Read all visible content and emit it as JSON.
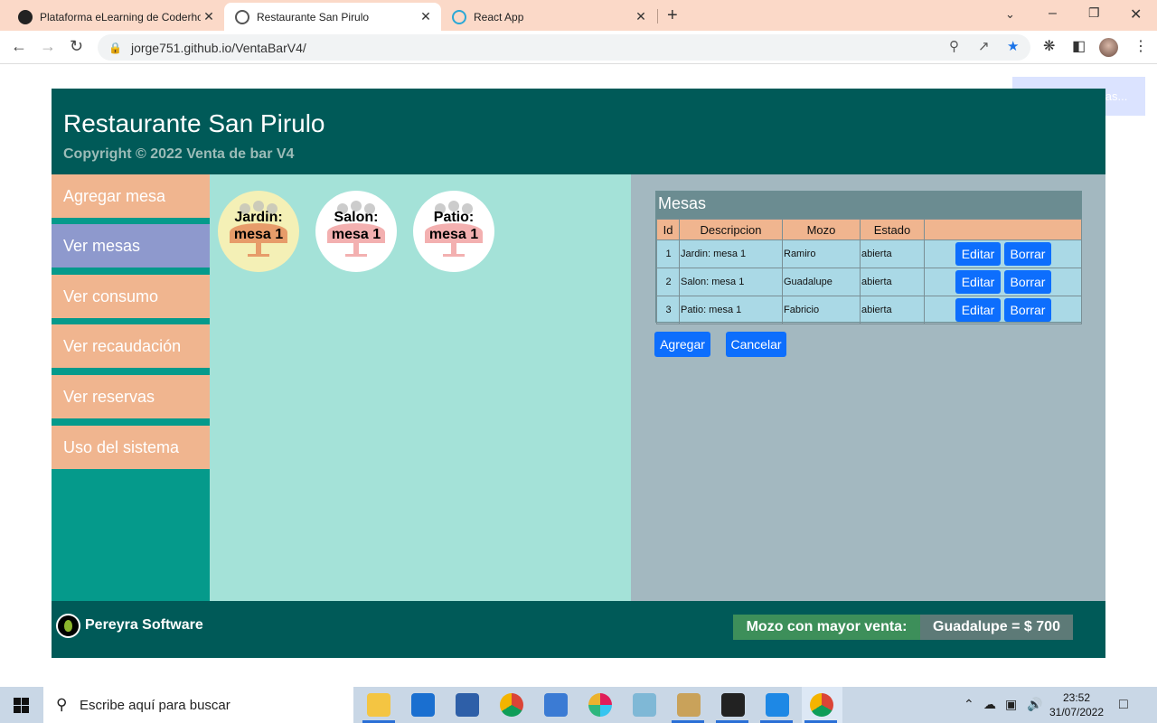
{
  "browser": {
    "tabs": [
      {
        "title": "Plataforma eLearning de Coderho",
        "close": "✕"
      },
      {
        "title": "Restaurante San Pirulo",
        "close": "✕"
      },
      {
        "title": "React App",
        "close": "✕"
      }
    ],
    "new_tab": "+",
    "url": "jorge751.github.io/VentaBarV4/"
  },
  "toast": "Todas las mesas...",
  "header": {
    "title": "Restaurante San Pirulo",
    "copyright": "Copyright © 2022 Venta de bar V4"
  },
  "sidebar": {
    "items": [
      {
        "label": "Agregar mesa",
        "active": false
      },
      {
        "label": "Ver mesas",
        "active": true
      },
      {
        "label": "Ver consumo",
        "active": false
      },
      {
        "label": "Ver recaudación",
        "active": false
      },
      {
        "label": "Ver reservas",
        "active": false
      },
      {
        "label": "Uso del sistema",
        "active": false
      }
    ]
  },
  "mesas_visual": [
    {
      "line1": "Jardin:",
      "line2": "mesa 1",
      "color": "#f4f0b6"
    },
    {
      "line1": "Salon:",
      "line2": "mesa 1",
      "color": "#ffffff"
    },
    {
      "line1": "Patio:",
      "line2": "mesa 1",
      "color": "#ffffff"
    }
  ],
  "mesas_panel": {
    "title": "Mesas",
    "columns": [
      "Id",
      "Descripcion",
      "Mozo",
      "Estado"
    ],
    "rows": [
      {
        "id": "1",
        "descripcion": "Jardin: mesa 1",
        "mozo": "Ramiro",
        "estado": "abierta"
      },
      {
        "id": "2",
        "descripcion": "Salon: mesa 1",
        "mozo": "Guadalupe",
        "estado": "abierta"
      },
      {
        "id": "3",
        "descripcion": "Patio: mesa 1",
        "mozo": "Fabricio",
        "estado": "abierta"
      }
    ],
    "edit_label": "Editar",
    "delete_label": "Borrar",
    "add_label": "Agregar",
    "cancel_label": "Cancelar"
  },
  "footer": {
    "brand": "Pereyra Software",
    "top_sale_label": "Mozo con mayor venta:",
    "top_sale_value": "Guadalupe = $ 700"
  },
  "taskbar": {
    "search_placeholder": "Escribe aquí para buscar",
    "time": "23:52",
    "date": "31/07/2022"
  }
}
